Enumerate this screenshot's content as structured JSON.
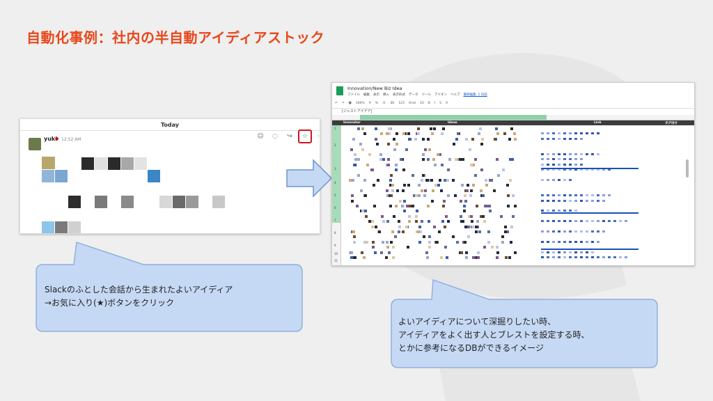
{
  "title": "自動化事例：社内の半自動アイディアストック",
  "slack": {
    "day": "Today",
    "user": "yuki",
    "time": "12:52 AM",
    "actions": [
      {
        "name": "add-reaction-icon",
        "glyph": "☺"
      },
      {
        "name": "reply-icon",
        "glyph": "◌"
      },
      {
        "name": "share-icon",
        "glyph": "↪"
      },
      {
        "name": "star-icon",
        "glyph": "☆"
      },
      {
        "name": "more-icon",
        "glyph": "⋯"
      }
    ]
  },
  "sheet": {
    "title": "Innovation/New Biz Idea",
    "menu": [
      "ファイル",
      "編集",
      "表示",
      "挿入",
      "表示形式",
      "データ",
      "ツール",
      "アドオン",
      "ヘルプ",
      "最終編集: 1 日前"
    ],
    "toolbar": [
      "↶",
      "↷",
      "🖶",
      "100%",
      "¥",
      "%",
      ".0",
      ".00",
      "123",
      "Arial",
      "10",
      "B",
      "I",
      "S",
      "A"
    ],
    "formula": "[ジャストアイデア]",
    "headers": [
      "Innovator",
      "Ideas",
      "Link",
      "タグ付け"
    ],
    "row_numbers": [
      "1",
      "2",
      "3",
      "4",
      "5",
      "6",
      "7",
      "8",
      "9",
      "10",
      "11"
    ]
  },
  "callout_left": {
    "line1": "Slackのふとした会話から生まれたよいアイディア",
    "line2": "→お気に入り(★)ボタンをクリック"
  },
  "callout_right": {
    "line1": "よいアイディアについて深掘りしたい時、",
    "line2": "アイディアをよく出す人とブレストを設定する時、",
    "line3": "とかに参考になるDBができるイメージ"
  },
  "colors": {
    "title": "#e8471a",
    "callout_fill": "#c6d9f4",
    "callout_stroke": "#8fb0dd",
    "star_highlight": "#d0161d",
    "sheet_green": "#8fd1a9"
  }
}
